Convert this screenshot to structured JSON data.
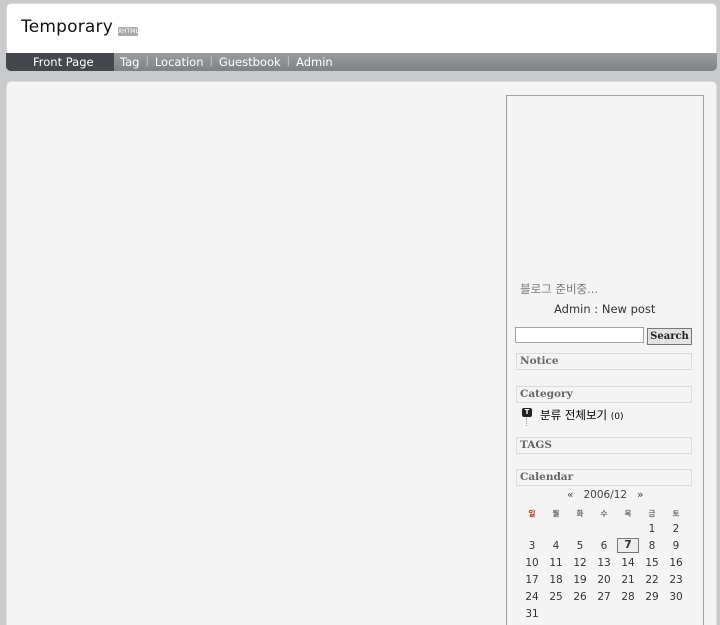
{
  "header": {
    "title": "Temporary",
    "badge": "XHTML"
  },
  "nav": {
    "items": [
      {
        "label": "Front Page",
        "active": true
      },
      {
        "label": "Tag"
      },
      {
        "label": "Location"
      },
      {
        "label": "Guestbook"
      },
      {
        "label": "Admin"
      }
    ]
  },
  "sidebar": {
    "notice_text": "블로그 준비중...",
    "admin_line": "Admin : New post",
    "search": {
      "value": "",
      "button": "Search"
    },
    "sections": {
      "notice": "Notice",
      "category": "Category",
      "tags": "TAGS",
      "calendar": "Calendar"
    },
    "category": {
      "icon_letter": "T",
      "label": "분류 전체보기",
      "count": "(0)"
    },
    "calendar": {
      "prev": "«",
      "month": "2006/12",
      "next": "»",
      "weekdays": [
        "일",
        "월",
        "화",
        "수",
        "목",
        "금",
        "토"
      ],
      "rows": [
        [
          "",
          "",
          "",
          "",
          "",
          "1",
          "2"
        ],
        [
          "3",
          "4",
          "5",
          "6",
          "7",
          "8",
          "9"
        ],
        [
          "10",
          "11",
          "12",
          "13",
          "14",
          "15",
          "16"
        ],
        [
          "17",
          "18",
          "19",
          "20",
          "21",
          "22",
          "23"
        ],
        [
          "24",
          "25",
          "26",
          "27",
          "28",
          "29",
          "30"
        ],
        [
          "31",
          "",
          "",
          "",
          "",
          "",
          ""
        ]
      ],
      "today": "7"
    }
  }
}
